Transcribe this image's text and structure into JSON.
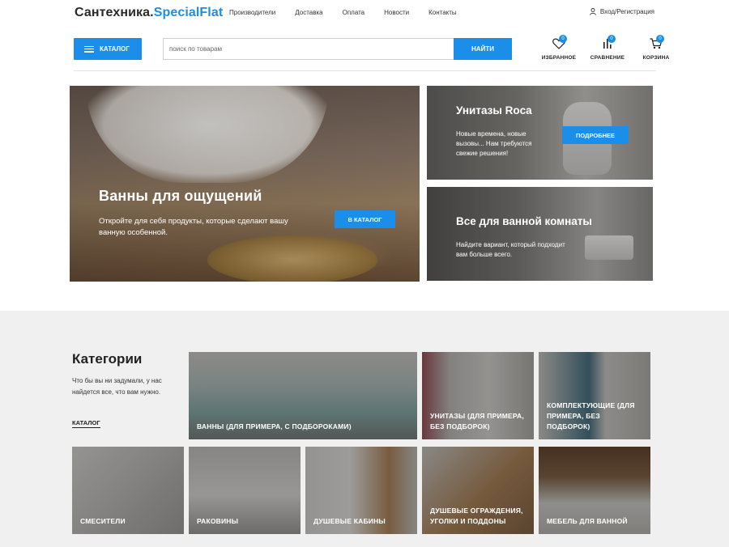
{
  "logo": {
    "part1": "Сантехника.",
    "part2": "SpecialFlat"
  },
  "topnav": [
    "Производители",
    "Доставка",
    "Оплата",
    "Новости",
    "Контакты"
  ],
  "login": {
    "label": "Вход/Регистрация",
    "icon": "user-icon"
  },
  "header": {
    "catalog_label": "КАТАЛОГ",
    "search_placeholder": "поиск по товарам",
    "search_button": "НАЙТИ",
    "favorites": {
      "label": "ИЗБРАННОЕ",
      "count": "0",
      "icon": "heart-icon"
    },
    "compare": {
      "label": "СРАВНЕНИЕ",
      "count": "0",
      "icon": "bar-chart-icon"
    },
    "cart": {
      "label": "КОРЗИНА",
      "count": "0",
      "icon": "cart-icon"
    }
  },
  "hero": {
    "title": "Ванны для ощущений",
    "text": "Откройте для себя продукты, которые сделают вашу ванную особенной.",
    "button": "В КАТАЛОГ"
  },
  "promos": [
    {
      "title": "Унитазы Roca",
      "text": "Новые времена, новые вызовы... Нам требуются свежие решения!",
      "button": "ПОДРОБНЕЕ"
    },
    {
      "title": "Все для ванной комнаты",
      "text": "Найдите вариант, который подходит вам больше всего."
    }
  ],
  "categories": {
    "title": "Категории",
    "text": "Что бы вы ни задумали, у нас найдется все, что вам нужно.",
    "link": "КАТАЛОГ",
    "items": [
      "ВАННЫ (ДЛЯ ПРИМЕРА, С ПОДБОРОКАМИ)",
      "УНИТАЗЫ (ДЛЯ ПРИМЕРА, БЕЗ ПОДБОРОК)",
      "КОМПЛЕКТУЮЩИЕ (ДЛЯ ПРИМЕРА, БЕЗ ПОДБОРОК)",
      "СМЕСИТЕЛИ",
      "РАКОВИНЫ",
      "ДУШЕВЫЕ КАБИНЫ",
      "ДУШЕВЫЕ ОГРАЖДЕНИЯ, УГОЛКИ И ПОДДОНЫ",
      "МЕБЕЛЬ ДЛЯ ВАННОЙ"
    ]
  },
  "colors": {
    "accent": "#1a8ee8",
    "section_bg": "#f0f0f0"
  }
}
